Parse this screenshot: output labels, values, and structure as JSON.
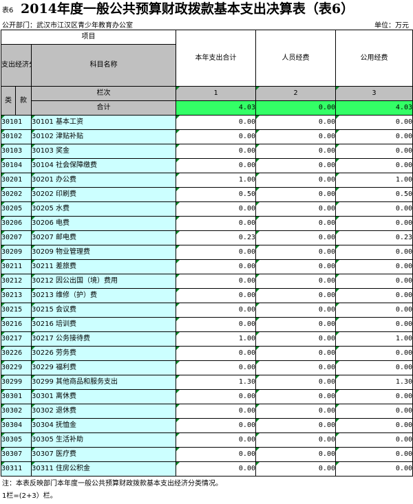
{
  "header": {
    "tag": "表6",
    "title": "2014年度一般公共预算财政拨款基本支出决算表（表6）",
    "dept": "公开部门：武汉市江汉区青少年教育办公室",
    "unit": "单位：万元"
  },
  "table": {
    "col_item": "项目",
    "col_code_group": "支出经济分类科目",
    "col_lei": "类",
    "col_kuan": "款",
    "col_name": "科目名称",
    "col_total": "本年支出合计",
    "col_personnel": "人员经费",
    "col_public": "公用经费",
    "lanci_label": "栏次",
    "lanci_1": "1",
    "lanci_2": "2",
    "lanci_3": "3",
    "total_label": "合计",
    "total_values": [
      "4.03",
      "0.00",
      "4.03"
    ],
    "rows": [
      {
        "code": "30101",
        "name": "30101 基本工资",
        "v": [
          "0.00",
          "0.00",
          "0.00"
        ]
      },
      {
        "code": "30102",
        "name": "30102 津贴补贴",
        "v": [
          "0.00",
          "0.00",
          "0.00"
        ]
      },
      {
        "code": "30103",
        "name": "30103 奖金",
        "v": [
          "0.00",
          "0.00",
          "0.00"
        ]
      },
      {
        "code": "30104",
        "name": "30104 社会保障缴费",
        "v": [
          "0.00",
          "0.00",
          "0.00"
        ]
      },
      {
        "code": "30201",
        "name": "30201 办公费",
        "v": [
          "1.00",
          "0.00",
          "1.00"
        ]
      },
      {
        "code": "30202",
        "name": "30202 印刷费",
        "v": [
          "0.50",
          "0.00",
          "0.50"
        ]
      },
      {
        "code": "30205",
        "name": "30205 水费",
        "v": [
          "0.00",
          "0.00",
          "0.00"
        ]
      },
      {
        "code": "30206",
        "name": "30206 电费",
        "v": [
          "0.00",
          "0.00",
          "0.00"
        ]
      },
      {
        "code": "30207",
        "name": "30207 邮电费",
        "v": [
          "0.23",
          "0.00",
          "0.23"
        ]
      },
      {
        "code": "30209",
        "name": "30209 物业管理费",
        "v": [
          "0.00",
          "0.00",
          "0.00"
        ]
      },
      {
        "code": "30211",
        "name": "30211 差旅费",
        "v": [
          "0.00",
          "0.00",
          "0.00"
        ]
      },
      {
        "code": "30212",
        "name": "30212 因公出国（境）费用",
        "v": [
          "0.00",
          "0.00",
          "0.00"
        ]
      },
      {
        "code": "30213",
        "name": "30213 维修（护）费",
        "v": [
          "0.00",
          "0.00",
          "0.00"
        ]
      },
      {
        "code": "30215",
        "name": "30215 会议费",
        "v": [
          "0.00",
          "0.00",
          "0.00"
        ]
      },
      {
        "code": "30216",
        "name": "30216 培训费",
        "v": [
          "0.00",
          "0.00",
          "0.00"
        ]
      },
      {
        "code": "30217",
        "name": "30217 公务接待费",
        "v": [
          "1.00",
          "0.00",
          "1.00"
        ]
      },
      {
        "code": "30226",
        "name": "30226 劳务费",
        "v": [
          "0.00",
          "0.00",
          "0.00"
        ]
      },
      {
        "code": "30229",
        "name": "30229 福利费",
        "v": [
          "0.00",
          "0.00",
          "0.00"
        ]
      },
      {
        "code": "30299",
        "name": "30299 其他商品和服务支出",
        "v": [
          "1.30",
          "0.00",
          "1.30"
        ]
      },
      {
        "code": "30301",
        "name": "30301 离休费",
        "v": [
          "0.00",
          "0.00",
          "0.00"
        ]
      },
      {
        "code": "30302",
        "name": "30302 退休费",
        "v": [
          "0.00",
          "0.00",
          "0.00"
        ]
      },
      {
        "code": "30304",
        "name": "30304 抚恤金",
        "v": [
          "0.00",
          "0.00",
          "0.00"
        ]
      },
      {
        "code": "30305",
        "name": "30305 生活补助",
        "v": [
          "0.00",
          "0.00",
          "0.00"
        ]
      },
      {
        "code": "30307",
        "name": "30307 医疗费",
        "v": [
          "0.00",
          "0.00",
          "0.00"
        ]
      },
      {
        "code": "30311",
        "name": "30311 住房公积金",
        "v": [
          "0.00",
          "0.00",
          "0.00"
        ]
      }
    ]
  },
  "notes": {
    "line1": "注：本表反映部门本年度一般公共预算财政拨款基本支出经济分类情况。",
    "line2": "1栏=(2+3）栏。"
  },
  "colors": {
    "header_gray": "#c0c0c0",
    "code_cyan": "#ccffff",
    "total_green": "#33ff66"
  }
}
